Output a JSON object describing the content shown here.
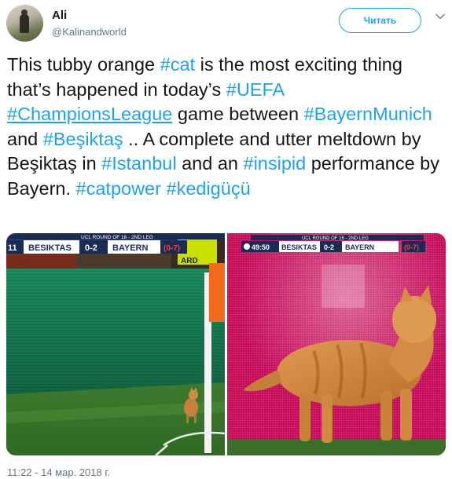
{
  "user": {
    "name": "Ali",
    "handle": "@Kalinandworld"
  },
  "follow_button": {
    "label": "Читать"
  },
  "tweet": {
    "seg1": "This tubby orange ",
    "tag_cat": "#cat",
    "seg2": " is the most exciting thing that’s happened in today’s ",
    "tag_uefa": "#UEFA",
    "seg3": " ",
    "tag_cl": "#ChampionsLeague",
    "seg4": " game between ",
    "tag_bayern": "#BayernMunich",
    "seg5": " and ",
    "tag_besiktas": "#Beşiktaş",
    "seg6": " .. A complete and utter meltdown by Beşiktaş in ",
    "tag_istanbul": "#Istanbul",
    "seg7": " and an ",
    "tag_insipid": "#insipid",
    "seg8": " performance by Bayern. ",
    "tag_catpower": "#catpower",
    "seg9": " ",
    "tag_kedi": "#kedigüçü"
  },
  "media": {
    "left": {
      "banner_small": "UCL ROUND OF 16 - 2ND LEG",
      "clock": "11",
      "team1": "BESIKTAS",
      "score": "0-2",
      "team2": "BAYERN",
      "agg": "(0-7)",
      "partial": "ARD"
    },
    "right": {
      "banner_small": "UCL ROUND OF 16 - 2ND LEG",
      "clock": "49:50",
      "team1": "BESIKTAS",
      "score": "0-2",
      "team2": "BAYERN",
      "agg": "(0-7)"
    }
  },
  "timestamp": "11:22 - 14 мар. 2018 г.",
  "colors": {
    "link": "#1da1f2",
    "text": "#14171a",
    "muted": "#657786"
  },
  "icons": {
    "menu": "chevron-down-icon"
  }
}
